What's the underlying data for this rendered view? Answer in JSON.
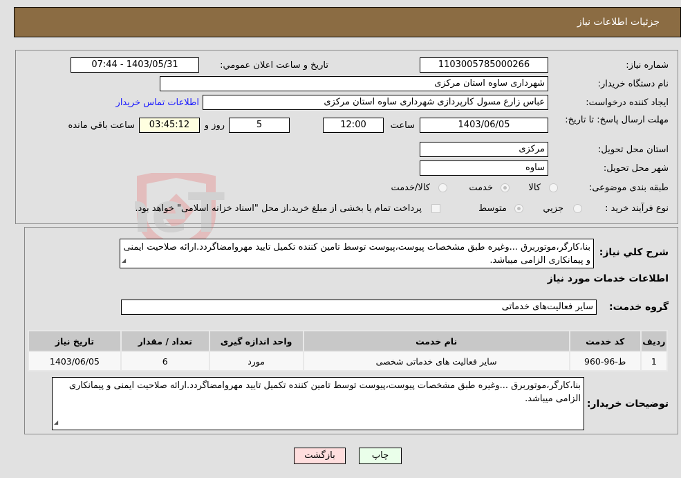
{
  "header": {
    "title": "جزئیات اطلاعات نیاز"
  },
  "fields": {
    "need_number": {
      "label": "شماره نیاز:",
      "value": "1103005785000266"
    },
    "announce_datetime": {
      "label": "تاریخ و ساعت اعلان عمومي:",
      "value": "1403/05/31 - 07:44"
    },
    "buyer_org": {
      "label": "نام دستگاه خریدار:",
      "value": "شهرداری ساوه استان مرکزی"
    },
    "creator": {
      "label": "ایجاد کننده درخواست:",
      "value": "عباس زارع مسول کارپردازی شهرداری ساوه استان مرکزی"
    },
    "buyer_contact_link": "اطلاعات تماس خریدار",
    "deadline": {
      "label": "مهلت ارسال پاسخ: تا تاریخ:",
      "date": "1403/06/05",
      "time_label": "ساعت",
      "time": "12:00",
      "days": "5",
      "days_label": "روز و",
      "remaining": "03:45:12",
      "remaining_label": "ساعت باقي مانده"
    },
    "province": {
      "label": "استان محل تحویل:",
      "value": "مرکزی"
    },
    "city": {
      "label": "شهر محل تحویل:",
      "value": "ساوه"
    },
    "category": {
      "label": "طبقه بندی موضوعی:",
      "options": [
        "کالا",
        "خدمت",
        "کالا/خدمت"
      ],
      "selected": "خدمت"
    },
    "purchase_type": {
      "label": "نوع فرآیند خرید :",
      "options": [
        "جزيي",
        "متوسط"
      ],
      "selected": "متوسط",
      "treasury_note": "پرداخت تمام یا بخشی از مبلغ خرید،از محل \"اسناد خزانه اسلامی\" خواهد بود.",
      "treasury_checked": false
    }
  },
  "description": {
    "label": "شرح کلي نیاز:",
    "value": "بنا،کارگر،موتوربرق ...وغیره طبق مشخصات پیوست،پیوست توسط تامین کننده تکمیل تایید مهروامضاگردد.ارائه صلاحیت ایمنی و پیمانکاری الزامی میباشد."
  },
  "services_section": {
    "title": "اطلاعات خدمات مورد نیاز",
    "group_label": "گروه خدمت:",
    "group_value": "سایر فعالیت‌های خدماتی"
  },
  "table": {
    "headers": [
      "ردیف",
      "کد خدمت",
      "نام خدمت",
      "واحد اندازه گیری",
      "تعداد / مقدار",
      "تاریخ نیاز"
    ],
    "rows": [
      [
        "1",
        "ط-96-960",
        "سایر فعالیت های خدماتی شخصی",
        "مورد",
        "6",
        "1403/06/05"
      ]
    ]
  },
  "buyer_notes": {
    "label": "توضیحات خریدار:",
    "value": "بنا،کارگر،موتوربرق ...وغیره طبق مشخصات پیوست،پیوست توسط تامین کننده تکمیل تایید مهروامضاگردد.ارائه صلاحیت ایمنی و پیمانکاری الزامی میباشد."
  },
  "buttons": {
    "print": "چاپ",
    "back": "بازگشت"
  },
  "watermark": "AriaTender.neT",
  "colors": {
    "header_bg": "#8b6c43",
    "print_bg": "#eaffea",
    "back_bg": "#ffdede",
    "link": "#1a1aff"
  }
}
